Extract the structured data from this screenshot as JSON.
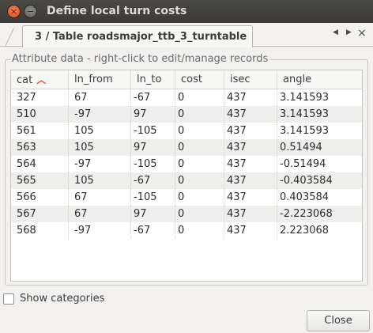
{
  "window": {
    "title": "Define local turn costs",
    "close_glyph": "×",
    "minimize_glyph": "−"
  },
  "tab": {
    "label": "3 / Table roadsmajor_ttb_3_turntable",
    "nav_left": "◀",
    "nav_right": "▶",
    "close_glyph": "×"
  },
  "group": {
    "label": "Attribute data - right-click to edit/manage records"
  },
  "table": {
    "columns": [
      "cat",
      "ln_from",
      "ln_to",
      "cost",
      "isec",
      "angle"
    ],
    "sort_column": "cat",
    "sort_icon": "chevron-up-icon",
    "rows": [
      [
        "327",
        "67",
        "-67",
        "0",
        "437",
        "3.141593"
      ],
      [
        "510",
        "-97",
        "97",
        "0",
        "437",
        "3.141593"
      ],
      [
        "561",
        "105",
        "-105",
        "0",
        "437",
        "3.141593"
      ],
      [
        "563",
        "105",
        "97",
        "0",
        "437",
        "0.51494"
      ],
      [
        "564",
        "-97",
        "-105",
        "0",
        "437",
        "-0.51494"
      ],
      [
        "565",
        "105",
        "-67",
        "0",
        "437",
        "-0.403584"
      ],
      [
        "566",
        "67",
        "-105",
        "0",
        "437",
        "0.403584"
      ],
      [
        "567",
        "67",
        "97",
        "0",
        "437",
        "-2.223068"
      ],
      [
        "568",
        "-97",
        "-67",
        "0",
        "437",
        "2.223068"
      ]
    ]
  },
  "options": {
    "show_categories_label": "Show categories",
    "show_categories_checked": false
  },
  "buttons": {
    "close_label": "Close"
  },
  "colors": {
    "accent": "#e95420",
    "titlebar": "#3c3b37",
    "window_bg": "#f2f1f0",
    "alt_row": "#eeeeec"
  }
}
